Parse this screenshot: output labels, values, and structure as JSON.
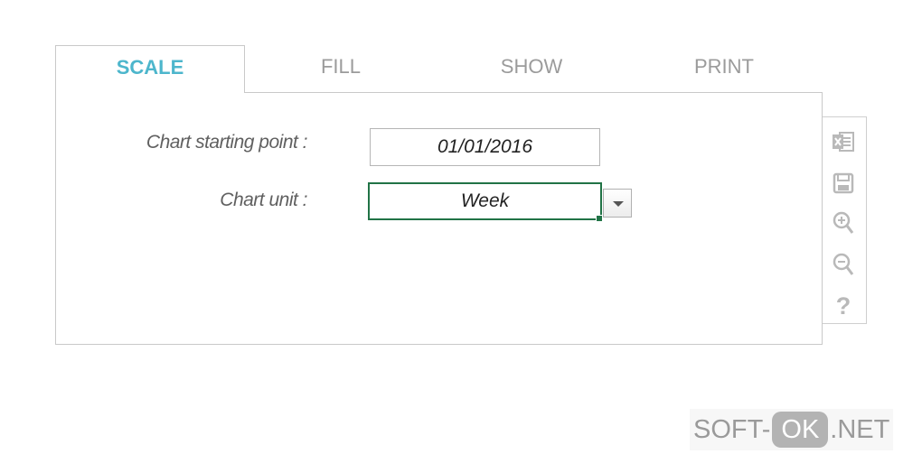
{
  "tabs": [
    {
      "label": "SCALE",
      "active": true
    },
    {
      "label": "FILL",
      "active": false
    },
    {
      "label": "SHOW",
      "active": false
    },
    {
      "label": "PRINT",
      "active": false
    }
  ],
  "form": {
    "start_label": "Chart starting point :",
    "start_value": "01/01/2016",
    "unit_label": "Chart unit :",
    "unit_value": "Week"
  },
  "toolbar": {
    "icons": [
      "excel-icon",
      "save-icon",
      "zoom-in-icon",
      "zoom-out-icon",
      "help-icon"
    ],
    "help_label": "?"
  },
  "watermark": {
    "prefix": "SOFT-",
    "ok": "OK",
    "suffix": ".NET"
  },
  "colors": {
    "active_tab": "#4db6cc",
    "selection_border": "#217346",
    "inactive_tab": "#9b9b9b"
  }
}
